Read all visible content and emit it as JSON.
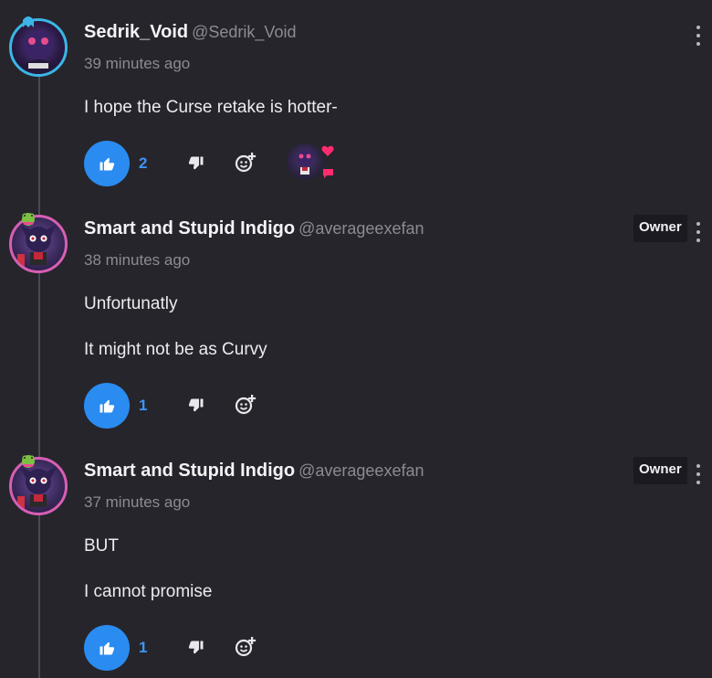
{
  "comments": [
    {
      "username": "Sedrik_Void",
      "handle": "@Sedrik_Void",
      "time": "39 minutes ago",
      "lines": [
        "I hope the Curse retake is hotter-"
      ],
      "likes": "2",
      "owner_tag": "",
      "has_reaction": true
    },
    {
      "username": "Smart and Stupid Indigo",
      "handle": "@averageexefan",
      "time": "38 minutes ago",
      "lines": [
        "Unfortunatly",
        "It might not be as Curvy"
      ],
      "likes": "1",
      "owner_tag": "Owner",
      "has_reaction": false
    },
    {
      "username": "Smart and Stupid Indigo",
      "handle": "@averageexefan",
      "time": "37 minutes ago",
      "lines": [
        "BUT",
        "I cannot promise"
      ],
      "likes": "1",
      "owner_tag": "Owner",
      "has_reaction": false
    }
  ],
  "colors": {
    "background": "#26252c",
    "like_button": "#2a8cf0",
    "like_count": "#3d95f2",
    "avatar_border_first": "#3bb6e6",
    "avatar_border_owner": "#d75fb4",
    "reaction_heart": "#ff2d6f"
  },
  "icons": [
    "thumbs-up-icon",
    "thumbs-down-icon",
    "add-reaction-icon",
    "more-options-icon",
    "heart-icon",
    "comment-icon"
  ]
}
